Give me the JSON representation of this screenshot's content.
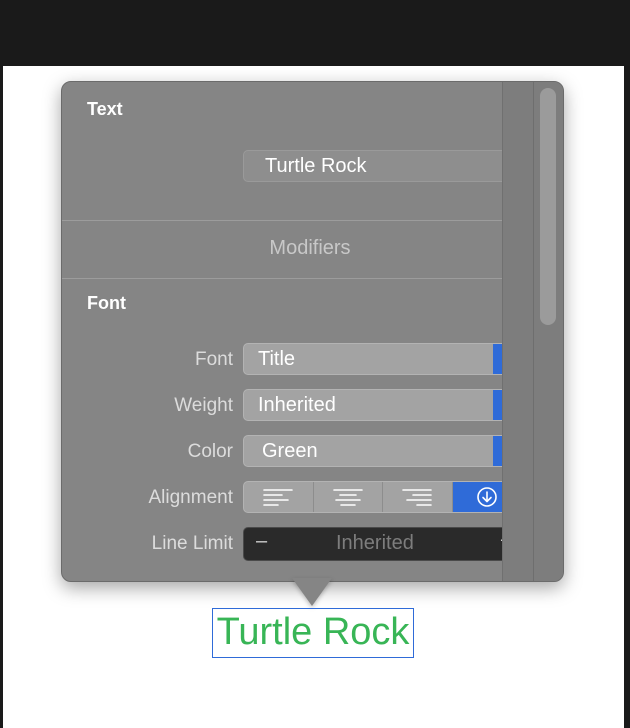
{
  "inspector": {
    "text_section": {
      "title": "Text",
      "value": "Turtle Rock"
    },
    "modifiers_label": "Modifiers",
    "font_section": {
      "title": "Font",
      "rows": {
        "font": {
          "label": "Font",
          "value": "Title"
        },
        "weight": {
          "label": "Weight",
          "value": "Inherited"
        },
        "color": {
          "label": "Color",
          "value": "Green"
        },
        "alignment": {
          "label": "Alignment",
          "options": [
            "align-left",
            "align-center",
            "align-right",
            "inherited"
          ],
          "selected": "inherited"
        },
        "line_limit": {
          "label": "Line Limit",
          "value": "Inherited",
          "decrement": "–",
          "increment": "+"
        }
      }
    }
  },
  "preview": {
    "text": "Turtle Rock",
    "text_color": "#38b556",
    "selection_color": "#2f6bd8"
  }
}
